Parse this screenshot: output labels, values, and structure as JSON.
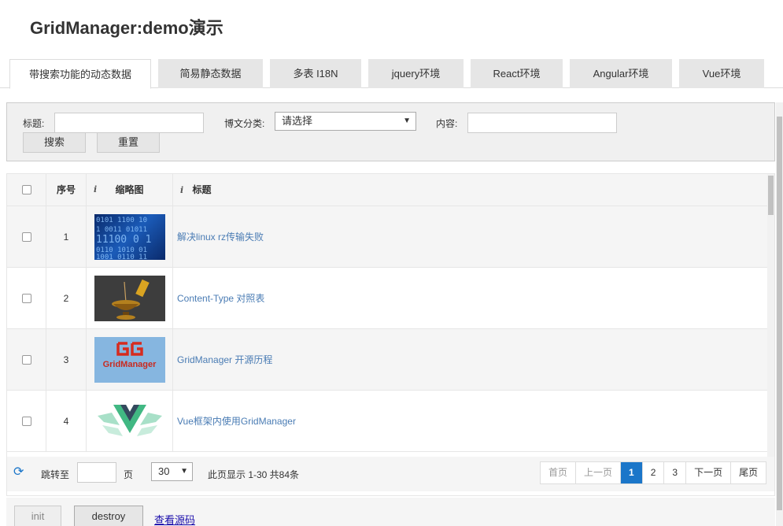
{
  "title": "GridManager:demo演示",
  "tabs": [
    {
      "label": "带搜索功能的动态数据",
      "active": true
    },
    {
      "label": "简易静态数据"
    },
    {
      "label": "多表 I18N"
    },
    {
      "label": "jquery环境"
    },
    {
      "label": "React环境"
    },
    {
      "label": "Angular环境"
    },
    {
      "label": "Vue环境"
    }
  ],
  "search": {
    "title_label": "标题:",
    "category_label": "博文分类:",
    "category_value": "请选择",
    "content_label": "内容:",
    "search_button": "搜索",
    "reset_button": "重置"
  },
  "table": {
    "headers": {
      "index": "序号",
      "thumb": "缩略图",
      "title": "标题"
    },
    "rows": [
      {
        "index": "1",
        "title": "解决linux rz传输失败",
        "thumb": "binary-code-image"
      },
      {
        "index": "2",
        "title": "Content-Type 对照表",
        "thumb": "incense-burner-image"
      },
      {
        "index": "3",
        "title": "GridManager 开源历程",
        "thumb": "gridmanager-logo-image",
        "thumb_text": "GridManager"
      },
      {
        "index": "4",
        "title": "Vue框架内使用GridManager",
        "thumb": "vue-logo-image"
      }
    ]
  },
  "footer": {
    "goto_label": "跳转至",
    "page_unit": "页",
    "page_size": "30",
    "summary": "此页显示 1-30 共84条",
    "pager": {
      "first": "首页",
      "prev": "上一页",
      "pages": [
        "1",
        "2",
        "3"
      ],
      "current": "1",
      "next": "下一页",
      "last": "尾页"
    }
  },
  "actions": {
    "init": "init",
    "destroy": "destroy",
    "view_source": "查看源码"
  },
  "colors": {
    "accent": "#1b76c9",
    "link": "#4a7cb4"
  }
}
